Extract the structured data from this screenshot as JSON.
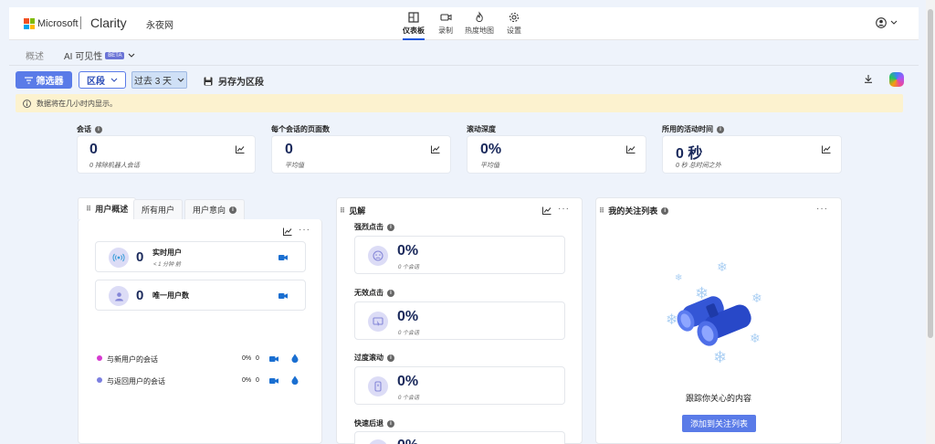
{
  "header": {
    "brand": "Microsoft",
    "product": "Clarity",
    "project": "永夜网",
    "nav": [
      {
        "label": "仪表板",
        "icon": "dashboard-icon"
      },
      {
        "label": "录制",
        "icon": "camera-icon"
      },
      {
        "label": "热度地图",
        "icon": "flame-icon"
      },
      {
        "label": "设置",
        "icon": "gear-icon"
      }
    ]
  },
  "subtabs": {
    "overview": "概述",
    "ai_visibility": "AI 可见性",
    "beta": "BETA"
  },
  "toolbar": {
    "filters": "筛选器",
    "segments": "区段",
    "date_range": "过去 3 天",
    "save_as_segment": "另存为区段"
  },
  "info_bar": {
    "message": "数据将在几小时内显示。"
  },
  "metrics": [
    {
      "label": "会话",
      "value": "0",
      "sub": "0 排除机器人会话"
    },
    {
      "label": "每个会话的页面数",
      "value": "0",
      "sub": "平均值"
    },
    {
      "label": "滚动深度",
      "value": "0%",
      "sub": "平均值"
    },
    {
      "label": "所用的活动时间",
      "value": "0 秒",
      "sub": "0 秒 总时间之外"
    }
  ],
  "users_panel": {
    "tabs": [
      "用户概述",
      "所有用户",
      "用户意向"
    ],
    "live_users": {
      "value": "0",
      "label": "实时用户",
      "sub": "< 1 分钟 前"
    },
    "unique_users": {
      "value": "0",
      "label": "唯一用户数"
    },
    "rows": [
      {
        "label": "与新用户的会话",
        "pct": "0%",
        "count": "0",
        "color": "#d63ad0"
      },
      {
        "label": "与返回用户的会话",
        "pct": "0%",
        "count": "0",
        "color": "#7b7fe0"
      }
    ]
  },
  "insights_panel": {
    "title": "见解",
    "items": [
      {
        "label": "强烈点击",
        "value": "0%",
        "sub": "0 个会话"
      },
      {
        "label": "无效点击",
        "value": "0%",
        "sub": "0 个会话"
      },
      {
        "label": "过度滚动",
        "value": "0%",
        "sub": "0 个会话"
      },
      {
        "label": "快速后退",
        "value": "0%",
        "sub": ""
      }
    ]
  },
  "watchlist_panel": {
    "title": "我的关注列表",
    "empty_text": "跟踪你关心的内容",
    "button": "添加到关注列表"
  },
  "colors": {
    "accent": "#5a7be8",
    "value_text": "#1b2a5c",
    "info_bg": "#fcf2cf"
  }
}
